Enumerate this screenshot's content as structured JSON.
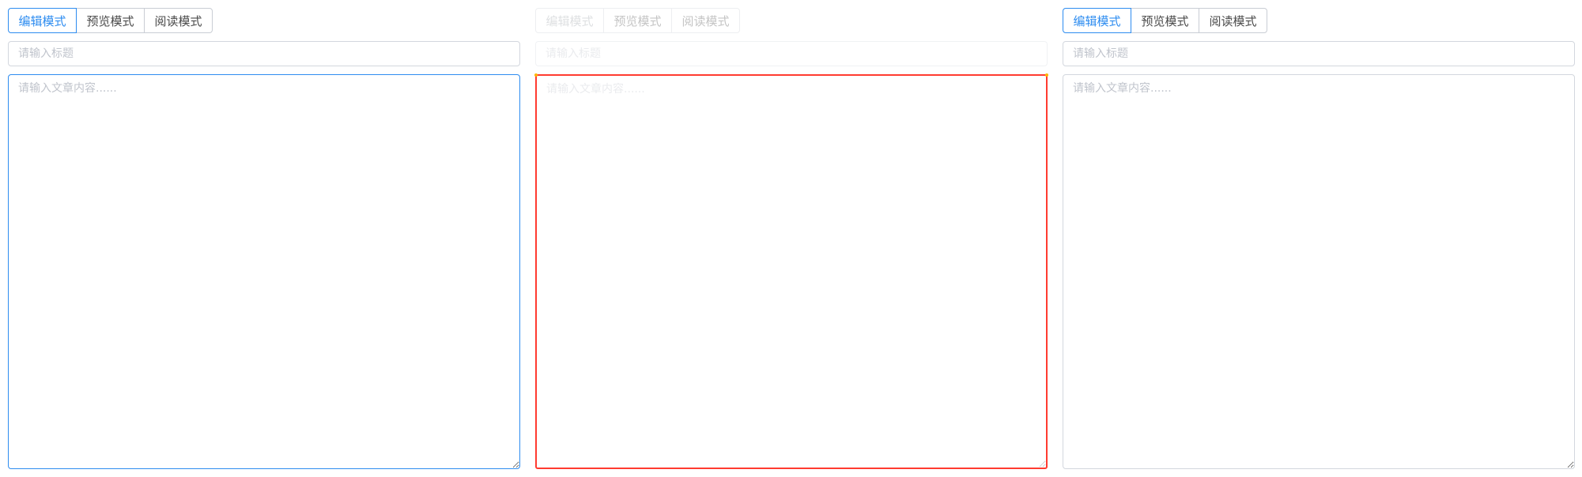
{
  "editors": [
    {
      "tabs": [
        "编辑模式",
        "预览模式",
        "阅读模式"
      ],
      "active_tab": "编辑模式",
      "title_placeholder": "请输入标题",
      "content_placeholder": "请输入文章内容......"
    },
    {
      "tabs": [
        "编辑模式",
        "预览模式",
        "阅读模式"
      ],
      "active_tab": "编辑模式",
      "title_placeholder": "请输入标题",
      "content_placeholder": "请输入文章内容......"
    },
    {
      "tabs": [
        "编辑模式",
        "预览模式",
        "阅读模式"
      ],
      "active_tab": "编辑模式",
      "title_placeholder": "请输入标题",
      "content_placeholder": "请输入文章内容......"
    }
  ],
  "colors": {
    "accent": "#2d8cf0",
    "border": "#d3d7de",
    "highlight": "#ff3b30"
  }
}
